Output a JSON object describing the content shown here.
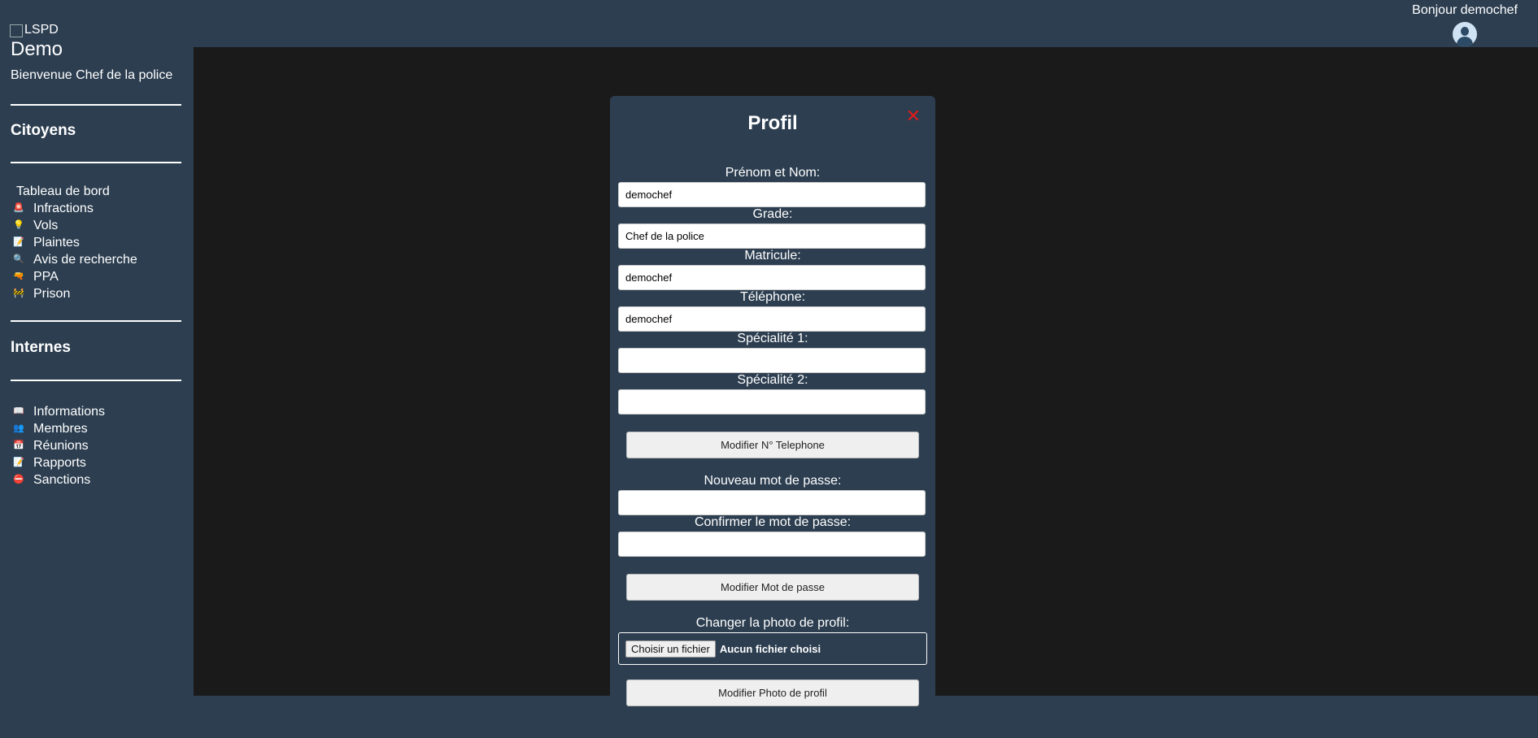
{
  "sidebar": {
    "logo_alt": "LSPD",
    "app_name": "Demo",
    "welcome": "Bienvenue Chef de la police",
    "citoyens_title": "Citoyens",
    "citoyens_items": [
      {
        "label": "Tableau de bord",
        "icon": ""
      },
      {
        "label": "Infractions",
        "icon": "siren-icon"
      },
      {
        "label": "Vols",
        "icon": "lightbulb-icon"
      },
      {
        "label": "Plaintes",
        "icon": "memo-icon"
      },
      {
        "label": "Avis de recherche",
        "icon": "magnifier-icon"
      },
      {
        "label": "PPA",
        "icon": "gun-icon"
      },
      {
        "label": "Prison",
        "icon": "barrier-icon"
      }
    ],
    "internes_title": "Internes",
    "internes_items": [
      {
        "label": "Informations",
        "icon": "book-icon"
      },
      {
        "label": "Membres",
        "icon": "people-icon"
      },
      {
        "label": "Réunions",
        "icon": "calendar-icon"
      },
      {
        "label": "Rapports",
        "icon": "memo-icon"
      },
      {
        "label": "Sanctions",
        "icon": "no-entry-icon"
      }
    ]
  },
  "header": {
    "greeting": "Bonjour demochef"
  },
  "modal": {
    "title": "Profil",
    "close": "✕",
    "name_label": "Prénom et Nom:",
    "name_value": "demochef",
    "grade_label": "Grade:",
    "grade_value": "Chef de la police",
    "matricule_label": "Matricule:",
    "matricule_value": "demochef",
    "phone_label": "Téléphone:",
    "phone_value": "demochef",
    "spec1_label": "Spécialité 1:",
    "spec1_value": "",
    "spec2_label": "Spécialité 2:",
    "spec2_value": "",
    "modify_phone_button": "Modifier N° Telephone",
    "new_password_label": "Nouveau mot de passe:",
    "confirm_password_label": "Confirmer le mot de passe:",
    "modify_password_button": "Modifier Mot de passe",
    "photo_label": "Changer la photo de profil:",
    "file_button": "Choisir un fichier",
    "file_status": "Aucun fichier choisi",
    "modify_photo_button": "Modifier Photo de profil"
  },
  "colors": {
    "sidebar_bg": "#2c3e50",
    "main_bg": "#1a1a1a",
    "close_red": "#e01b1b"
  }
}
